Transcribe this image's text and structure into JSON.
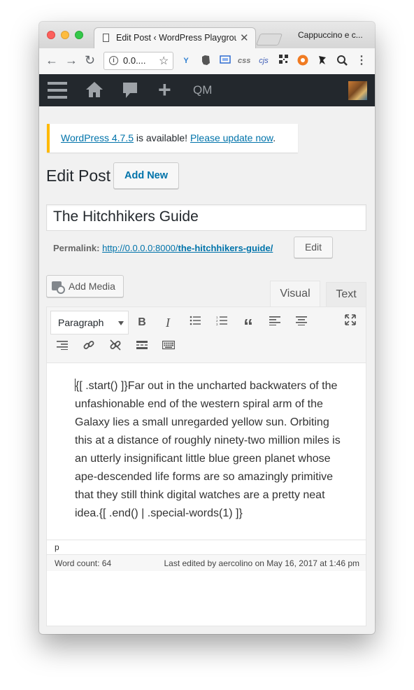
{
  "browser": {
    "tab_title": "Edit Post ‹ WordPress Playground",
    "profile_name": "Cappuccino e c...",
    "url": "0.0....",
    "extensions": [
      "vue-devtools-icon",
      "evernote-icon",
      "screenshot-icon",
      "css-icon",
      "cjs-icon",
      "qr-code-icon",
      "lastpass-icon",
      "ninja-icon",
      "search-magnifier-icon"
    ],
    "extension_labels": {
      "css": "css",
      "cjs": "cjs"
    }
  },
  "adminbar": {
    "qm_label": "QM"
  },
  "notice": {
    "version_link": "WordPress 4.7.5",
    "middle_text": " is available! ",
    "update_link": "Please update now",
    "end_text": "."
  },
  "page": {
    "title": "Edit Post",
    "add_new": "Add New"
  },
  "post": {
    "title": "The Hitchhikers Guide",
    "permalink_label": "Permalink:",
    "permalink_base": "http://0.0.0.0:8000/",
    "permalink_slug": "the-hitchhikers-guide/",
    "permalink_edit": "Edit"
  },
  "editor": {
    "add_media": "Add Media",
    "tab_visual": "Visual",
    "tab_text": "Text",
    "format": "Paragraph",
    "content": "{[ .start() ]}Far out in the uncharted backwaters of the unfashionable end of the western spiral arm of the Galaxy lies a small unregarded yellow sun. Orbiting this at a distance of roughly ninety-two million miles is an utterly insignificant little blue green planet whose ape-descended life forms are so amazingly primitive that they still think digital watches are a pretty neat idea.{[ .end() | .special-words(1) ]}",
    "path": "p",
    "word_count": "Word count: 64",
    "last_edited": "Last edited by aercolino on May 16, 2017 at 1:46 pm"
  }
}
